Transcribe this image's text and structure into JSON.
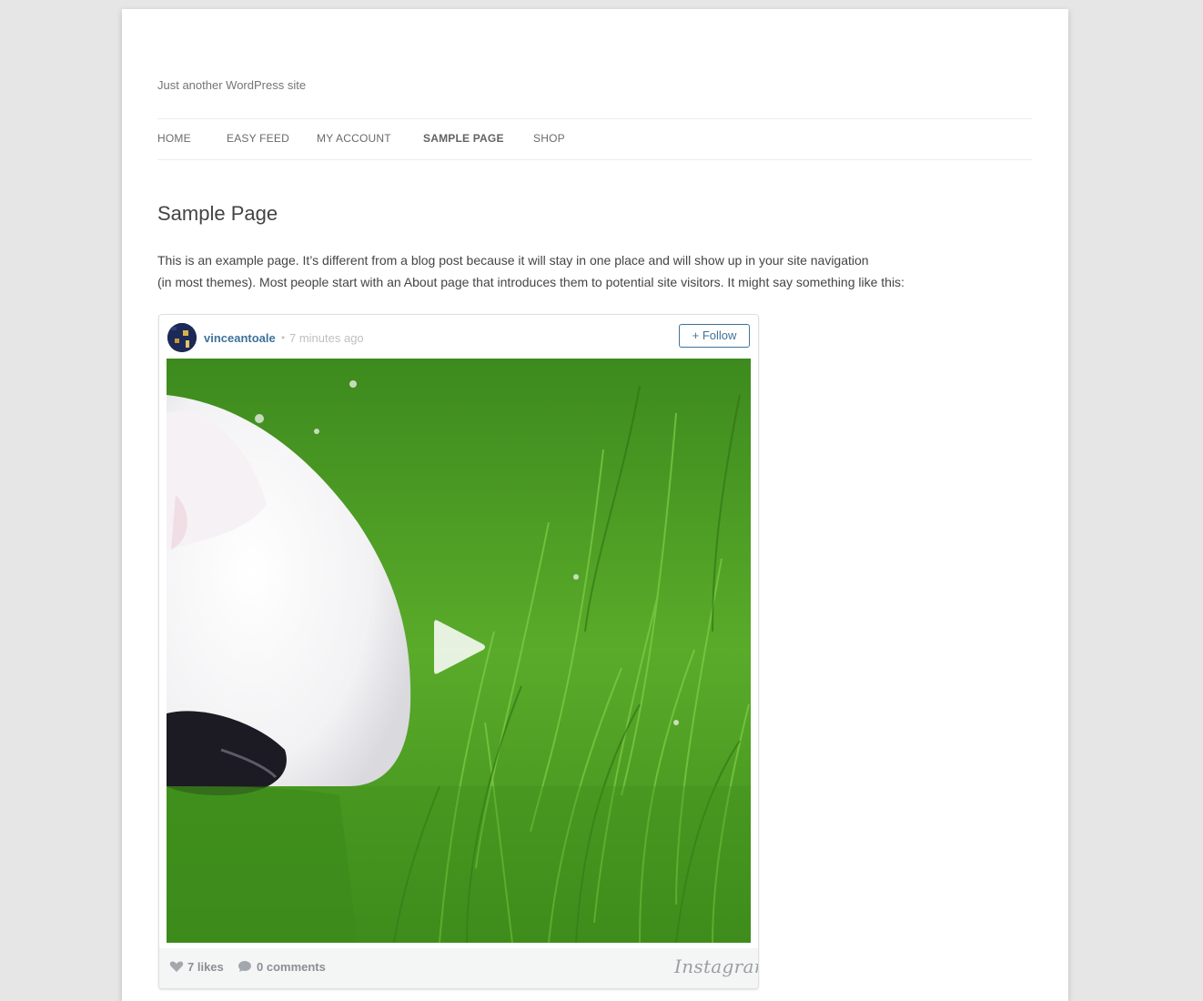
{
  "site": {
    "tagline": "Just another WordPress site"
  },
  "nav": {
    "items": [
      {
        "label": "Home",
        "active": false
      },
      {
        "label": "Easy Feed",
        "active": false
      },
      {
        "label": "My Account",
        "active": false
      },
      {
        "label": "Sample Page",
        "active": true
      },
      {
        "label": "Shop",
        "active": false
      }
    ]
  },
  "entry": {
    "title": "Sample Page",
    "line1": "This is an example page. It’s different from a blog post because it will stay in one place and will show up in your site navigation",
    "line2": "(in most themes). Most people start with an About page that introduces them to potential site visitors. It might say something like this:"
  },
  "instagram": {
    "username": "vinceantoale",
    "separator": "•",
    "time_ago": "7 minutes ago",
    "follow_label": "+ Follow",
    "likes_label": "7 likes",
    "comments_label": "0 comments",
    "logo_text": "Instagram",
    "accent_color": "#3f729b",
    "icons": [
      "heart-icon",
      "comment-icon",
      "play-icon"
    ]
  }
}
